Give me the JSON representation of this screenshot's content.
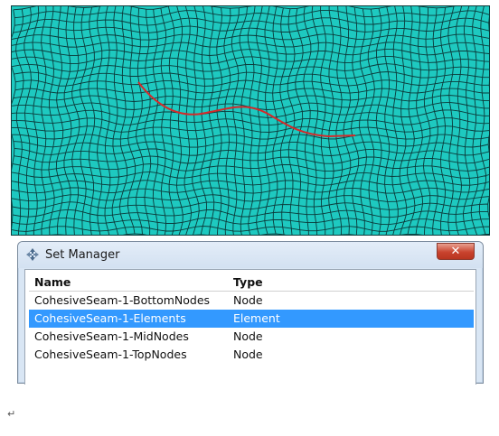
{
  "mesh": {
    "background_color": "#1ec9c0",
    "line_color": "#0b3a3a",
    "seam_color": "#d42a2a"
  },
  "window": {
    "title": "Set Manager",
    "icon": "set-manager-icon",
    "close_glyph": "✕"
  },
  "table": {
    "columns": [
      "Name",
      "Type"
    ],
    "rows": [
      {
        "name": "CohesiveSeam-1-BottomNodes",
        "type": "Node",
        "selected": false
      },
      {
        "name": "CohesiveSeam-1-Elements",
        "type": "Element",
        "selected": true
      },
      {
        "name": "CohesiveSeam-1-MidNodes",
        "type": "Node",
        "selected": false
      },
      {
        "name": "CohesiveSeam-1-TopNodes",
        "type": "Node",
        "selected": false
      }
    ]
  },
  "paragraph_mark": "↵"
}
